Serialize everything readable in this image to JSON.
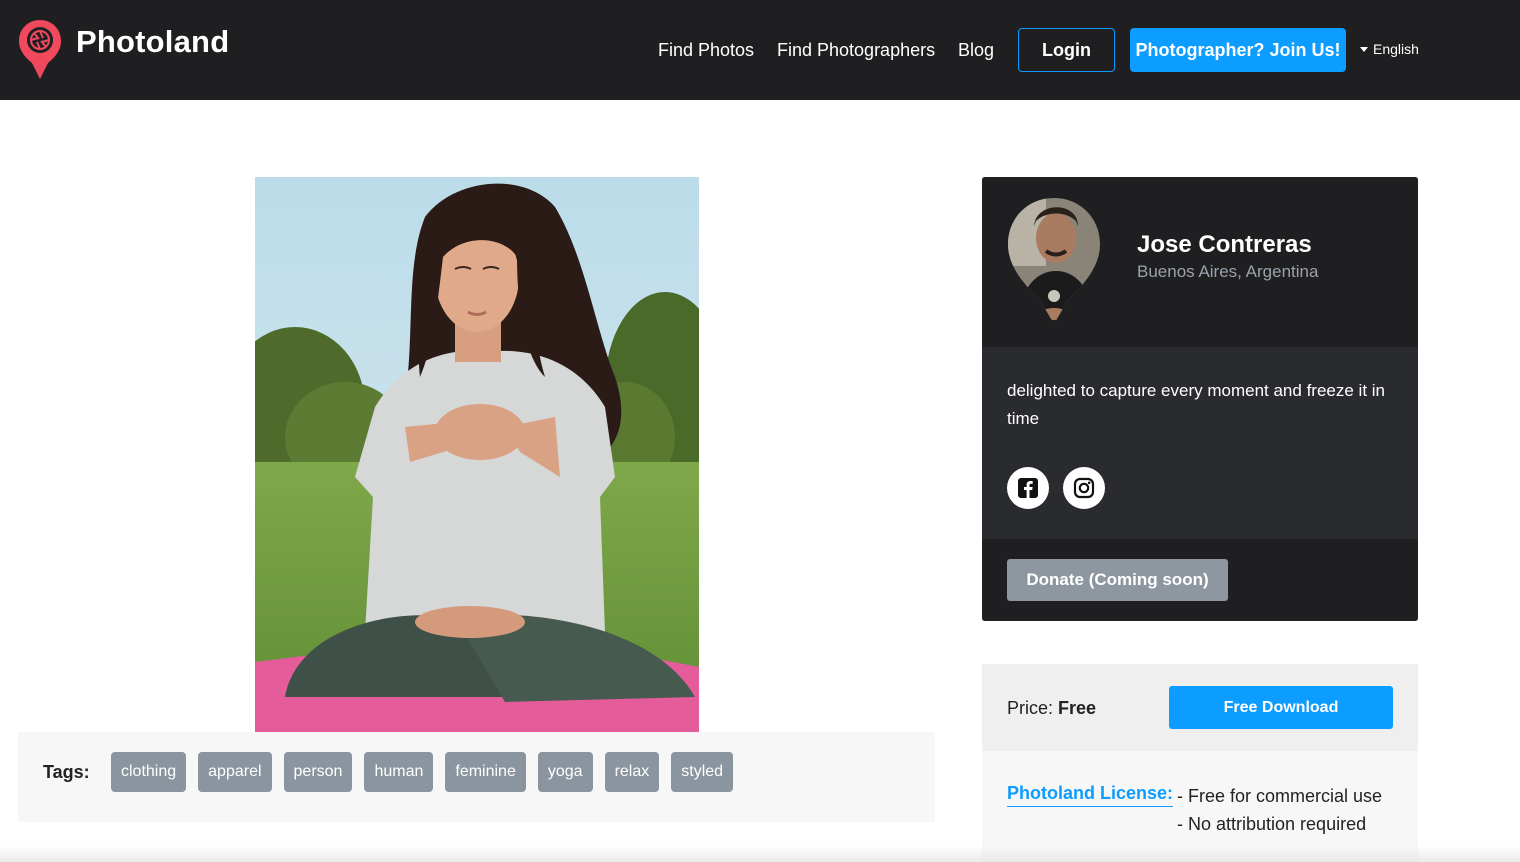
{
  "header": {
    "brand": "Photoland",
    "nav": [
      "Find Photos",
      "Find Photographers",
      "Blog"
    ],
    "login_label": "Login",
    "join_label": "Photographer? Join Us!",
    "language": "English"
  },
  "tags": {
    "label": "Tags:",
    "items": [
      "clothing",
      "apparel",
      "person",
      "human",
      "feminine",
      "yoga",
      "relax",
      "styled"
    ]
  },
  "photographer": {
    "name": "Jose Contreras",
    "location": "Buenos Aires, Argentina",
    "bio": "delighted to capture every moment and freeze it in time",
    "donate_label": "Donate (Coming soon)"
  },
  "pricing": {
    "price_label": "Price:",
    "price_value": "Free",
    "download_label": "Free Download",
    "license_label": "Photoland License:",
    "license_items": [
      "- Free for commercial use",
      "- No attribution required"
    ]
  },
  "colors": {
    "header_bg": "#1f1f22",
    "accent": "#0d9cff",
    "brand_pin": "#f0485c",
    "tag_bg": "#8a959f"
  },
  "icons": [
    "photoland-pin-logo-icon",
    "caret-down-icon",
    "facebook-icon",
    "instagram-icon"
  ]
}
